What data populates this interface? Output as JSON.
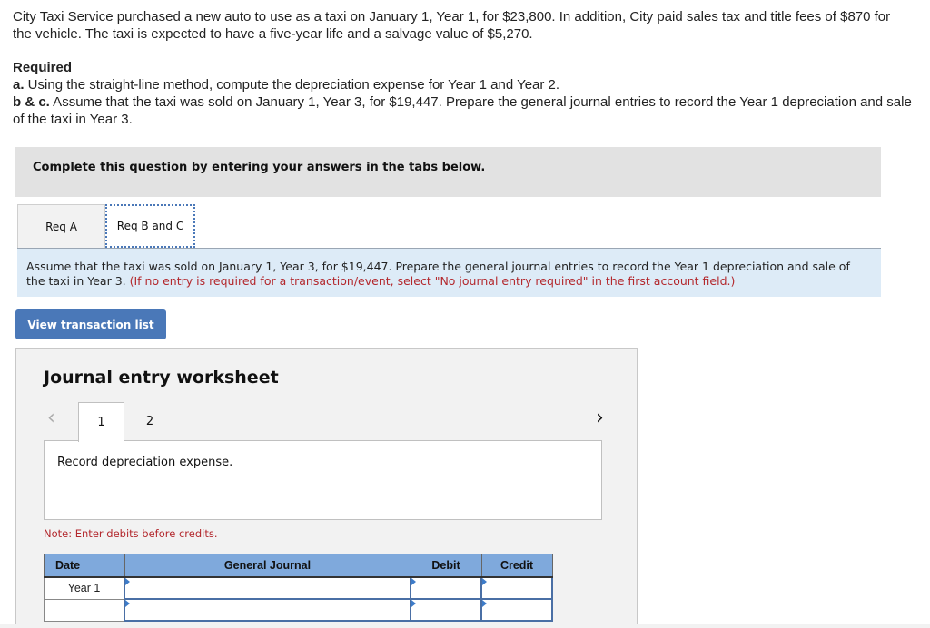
{
  "problem": {
    "intro": "City Taxi Service purchased a new auto to use as a taxi on January 1, Year 1, for $23,800. In addition, City paid sales tax and title fees of $870 for the vehicle. The taxi is expected to have a five-year life and a salvage value of $5,270.",
    "required_title": "Required",
    "req_a_label": "a.",
    "req_a_text": " Using the straight-line method, compute the depreciation expense for Year 1 and Year 2.",
    "req_bc_label": "b & c.",
    "req_bc_text": " Assume that the taxi was sold on January 1, Year 3, for $19,447. Prepare the general journal entries to record the Year 1 depreciation and sale of the taxi in Year 3."
  },
  "instructions": "Complete this question by entering your answers in the tabs below.",
  "tabs": [
    {
      "label": "Req A",
      "active": false
    },
    {
      "label": "Req B and C",
      "active": true
    }
  ],
  "prompt": {
    "text": "Assume that the taxi was sold on January 1, Year 3, for $19,447. Prepare the general journal entries to record the Year 1 depreciation and sale of the taxi in Year 3. ",
    "hint": "(If no entry is required for a transaction/event, select \"No journal entry required\" in the first account field.)"
  },
  "view_transaction_button": "View transaction list",
  "worksheet": {
    "title": "Journal entry worksheet",
    "prev_icon": "‹",
    "next_icon": "›",
    "pages": [
      "1",
      "2"
    ],
    "active_page": "1",
    "description": "Record depreciation expense.",
    "note": "Note: Enter debits before credits.",
    "table": {
      "headers": [
        "Date",
        "General Journal",
        "Debit",
        "Credit"
      ],
      "rows": [
        {
          "date": "Year 1",
          "account": "",
          "debit": "",
          "credit": ""
        },
        {
          "date": "",
          "account": "",
          "debit": "",
          "credit": ""
        }
      ]
    }
  },
  "colors": {
    "accent_blue": "#4a78b8",
    "header_blue": "#7fa9dc",
    "prompt_bg": "#ddebf7",
    "hint_red": "#b3282d",
    "panel_gray": "#f2f2f2"
  }
}
